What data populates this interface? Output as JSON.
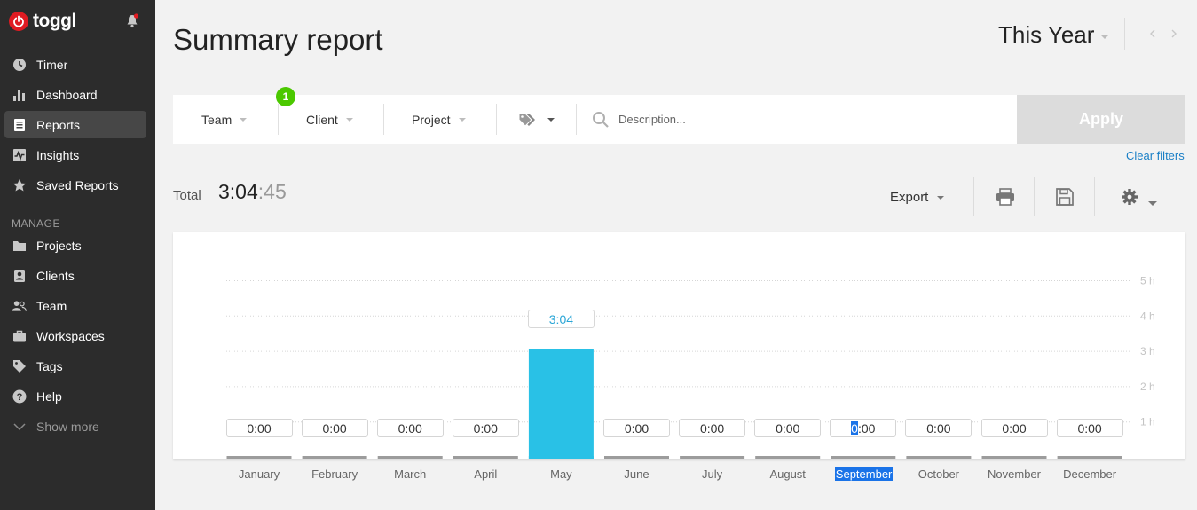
{
  "app": {
    "brand": "toggl"
  },
  "sidebar": {
    "items": [
      {
        "label": "Timer",
        "icon": "clock-icon"
      },
      {
        "label": "Dashboard",
        "icon": "bar-chart-icon"
      },
      {
        "label": "Reports",
        "icon": "document-icon",
        "active": true
      },
      {
        "label": "Insights",
        "icon": "pulse-icon"
      },
      {
        "label": "Saved Reports",
        "icon": "star-icon"
      }
    ],
    "manage_label": "MANAGE",
    "manage_items": [
      {
        "label": "Projects",
        "icon": "folder-icon"
      },
      {
        "label": "Clients",
        "icon": "contact-icon"
      },
      {
        "label": "Team",
        "icon": "users-icon"
      },
      {
        "label": "Workspaces",
        "icon": "briefcase-icon"
      },
      {
        "label": "Tags",
        "icon": "tag-icon"
      },
      {
        "label": "Help",
        "icon": "help-icon"
      },
      {
        "label": "Show more",
        "icon": "chevron-down-icon"
      }
    ]
  },
  "header": {
    "title": "Summary report",
    "period": "This Year"
  },
  "filters": {
    "team_label": "Team",
    "team_badge": "1",
    "client_label": "Client",
    "project_label": "Project",
    "description_placeholder": "Description...",
    "apply_label": "Apply",
    "clear_label": "Clear filters"
  },
  "total": {
    "label": "Total",
    "hours_minutes": "3:04",
    "seconds": ":45"
  },
  "toolbar": {
    "export_label": "Export"
  },
  "colors": {
    "accent": "#29c1e6",
    "brand": "#e01b22",
    "badge": "#4bc800",
    "link": "#1a7fc6"
  },
  "chart_data": {
    "type": "bar",
    "categories": [
      "January",
      "February",
      "March",
      "April",
      "May",
      "June",
      "July",
      "August",
      "September",
      "October",
      "November",
      "December"
    ],
    "values": [
      0,
      0,
      0,
      0,
      3.0792,
      0,
      0,
      0,
      0,
      0,
      0,
      0
    ],
    "value_labels": [
      "0:00",
      "0:00",
      "0:00",
      "0:00",
      "3:04",
      "0:00",
      "0:00",
      "0:00",
      "0:00",
      "0:00",
      "0:00",
      "0:00"
    ],
    "y_ticks": [
      "1 h",
      "2 h",
      "3 h",
      "4 h",
      "5 h"
    ],
    "ylim": [
      0,
      5
    ],
    "grid": true
  }
}
